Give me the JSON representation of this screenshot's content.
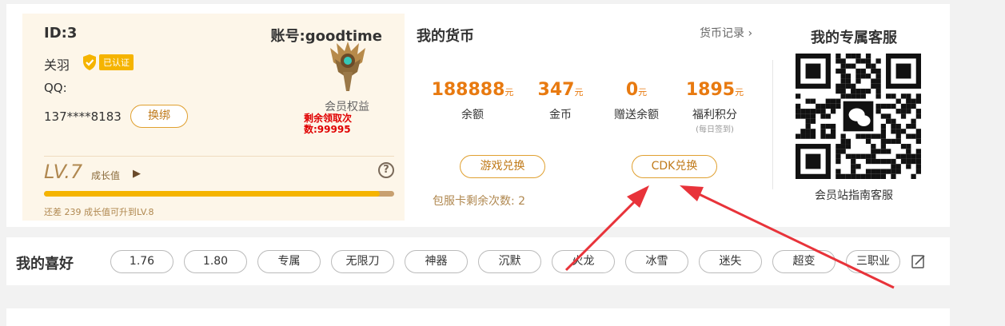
{
  "profile": {
    "id": "ID:3",
    "account": "账号:goodtime",
    "name": "关羽",
    "verified": "已认证",
    "qq": "QQ:",
    "phone": "137****8183",
    "rebind": "换绑",
    "vip_label": "会员权益",
    "remain": "剩余领取次数:99995",
    "level": "LV.7",
    "growth": "成长值",
    "level_progress": 0.96,
    "level_tip": "还差 239 成长值可升到LV.8"
  },
  "currency": {
    "title": "我的货币",
    "log": "货币记录",
    "stats": [
      {
        "value": "188888",
        "unit": "元",
        "label": "余额",
        "sub": ""
      },
      {
        "value": "347",
        "unit": "元",
        "label": "金币",
        "sub": ""
      },
      {
        "value": "0",
        "unit": "元",
        "label": "赠送余额",
        "sub": ""
      },
      {
        "value": "1895",
        "unit": "元",
        "label": "福利积分",
        "sub": "(每日签到)"
      }
    ],
    "exchange": "游戏兑换",
    "cdk": "CDK兑换",
    "pack": "包服卡剩余次数: 2"
  },
  "service": {
    "title": "我的专属客服",
    "caption": "会员站指南客服"
  },
  "preferences": {
    "title": "我的喜好",
    "chips": [
      "1.76",
      "1.80",
      "专属",
      "无限刀",
      "神器",
      "沉默",
      "火龙",
      "冰雪",
      "迷失",
      "超变",
      "三职业"
    ]
  },
  "colors": {
    "accent": "#e87a10",
    "gold": "#f5b400",
    "annotation": "#e8333a"
  }
}
